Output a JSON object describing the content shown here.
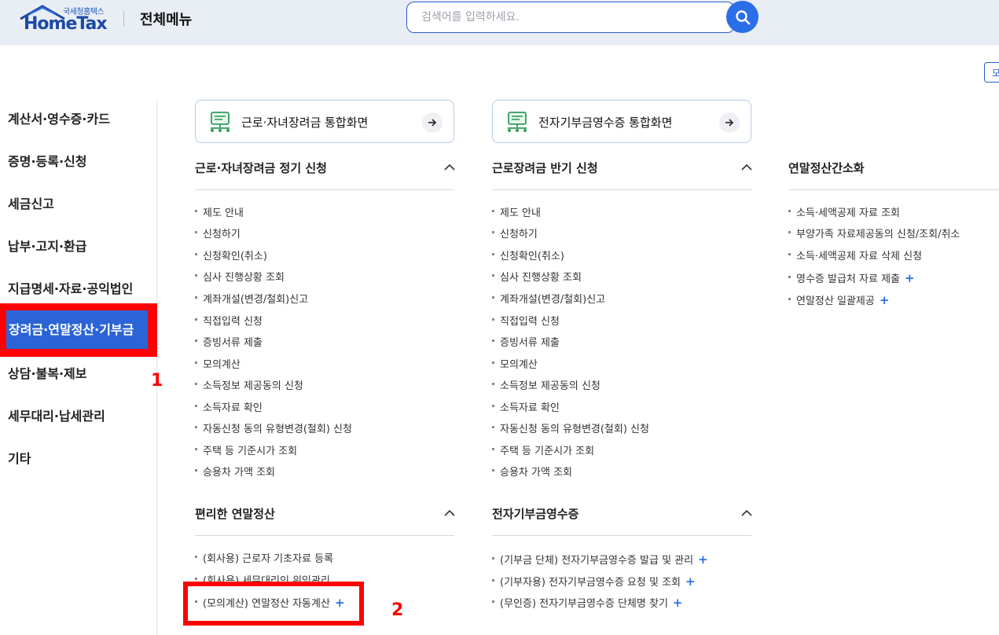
{
  "header": {
    "logo_small": "국세청홈택스",
    "logo_big": "HomeTax",
    "title": "전체메뉴",
    "search_placeholder": "검색어를 입력하세요.",
    "edge_button": "모"
  },
  "sidebar": {
    "items": [
      {
        "label": "계산서·영수증·카드"
      },
      {
        "label": "증명·등록·신청"
      },
      {
        "label": "세금신고"
      },
      {
        "label": "납부·고지·환급"
      },
      {
        "label": "지급명세·자료·공익법인"
      },
      {
        "label": "장려금·연말정산·기부금"
      },
      {
        "label": "상담·불복·제보"
      },
      {
        "label": "세무대리·납세관리"
      },
      {
        "label": "기타"
      }
    ]
  },
  "annotations": {
    "one": "1",
    "two": "2"
  },
  "shortcuts": [
    {
      "label": "근로·자녀장려금 통합화면"
    },
    {
      "label": "전자기부금영수증 통합화면"
    }
  ],
  "sections": {
    "col1_top": {
      "title": "근로·자녀장려금 정기 신청",
      "items": [
        "제도 안내",
        "신청하기",
        "신청확인(취소)",
        "심사 진행상황 조회",
        "계좌개설(변경/철회)신고",
        "직접입력 신청",
        "증빙서류 제출",
        "모의계산",
        "소득정보 제공동의 신청",
        "소득자료 확인",
        "자동신청 동의 유형변경(철회) 신청",
        "주택 등 기준시가 조회",
        "승용차 가액 조회"
      ]
    },
    "col2_top": {
      "title": "근로장려금 반기 신청",
      "items": [
        "제도 안내",
        "신청하기",
        "신청확인(취소)",
        "심사 진행상황 조회",
        "계좌개설(변경/철회)신고",
        "직접입력 신청",
        "증빙서류 제출",
        "모의계산",
        "소득정보 제공동의 신청",
        "소득자료 확인",
        "자동신청 동의 유형변경(철회) 신청",
        "주택 등 기준시가 조회",
        "승용차 가액 조회"
      ]
    },
    "col3_top": {
      "title": "연말정산간소화",
      "items": [
        "소득·세액공제 자료 조회",
        "부양가족 자료제공동의 신청/조회/취소",
        "소득·세액공제 자료 삭제 신청",
        "영수증 발급처 자료 제출",
        "연말정산 일괄제공"
      ]
    },
    "col1_bottom": {
      "title": "편리한 연말정산",
      "items": [
        "(회사용) 근로자 기초자료 등록",
        "(회사용) 세무대리인 위임관리",
        "(모의계산) 연말정산 자동계산"
      ]
    },
    "col2_bottom": {
      "title": "전자기부금영수증",
      "items": [
        "(기부금 단체) 전자기부금영수증 발급 및 관리",
        "(기부자용) 전자기부금영수증 요청 및 조회",
        "(무인증) 전자기부금영수증 단체명 찾기"
      ]
    }
  },
  "plus_symbol": "+"
}
